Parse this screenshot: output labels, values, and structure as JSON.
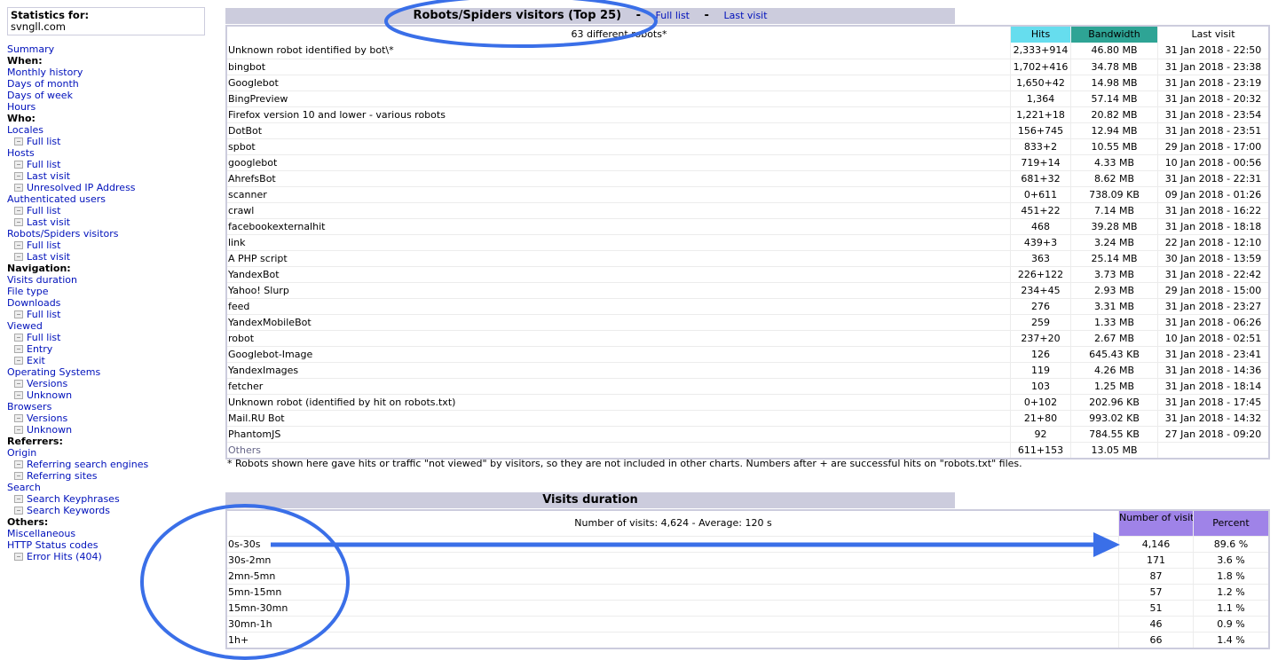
{
  "sidebar": {
    "stat_label": "Statistics for:",
    "site": "svngll.com",
    "items": [
      {
        "label": "Summary",
        "type": "link"
      },
      {
        "label": "When:",
        "type": "header"
      },
      {
        "label": "Monthly history",
        "type": "link"
      },
      {
        "label": "Days of month",
        "type": "link"
      },
      {
        "label": "Days of week",
        "type": "link"
      },
      {
        "label": "Hours",
        "type": "link"
      },
      {
        "label": "Who:",
        "type": "header"
      },
      {
        "label": "Locales",
        "type": "link"
      },
      {
        "label": "Full list",
        "type": "sub"
      },
      {
        "label": "Hosts",
        "type": "link"
      },
      {
        "label": "Full list",
        "type": "sub"
      },
      {
        "label": "Last visit",
        "type": "sub"
      },
      {
        "label": "Unresolved IP Address",
        "type": "sub"
      },
      {
        "label": "Authenticated users",
        "type": "link"
      },
      {
        "label": "Full list",
        "type": "sub"
      },
      {
        "label": "Last visit",
        "type": "sub"
      },
      {
        "label": "Robots/Spiders visitors",
        "type": "link"
      },
      {
        "label": "Full list",
        "type": "sub"
      },
      {
        "label": "Last visit",
        "type": "sub"
      },
      {
        "label": "Navigation:",
        "type": "header"
      },
      {
        "label": "Visits duration",
        "type": "link"
      },
      {
        "label": "File type",
        "type": "link"
      },
      {
        "label": "Downloads",
        "type": "link"
      },
      {
        "label": "Full list",
        "type": "sub"
      },
      {
        "label": "Viewed",
        "type": "link"
      },
      {
        "label": "Full list",
        "type": "sub"
      },
      {
        "label": "Entry",
        "type": "sub"
      },
      {
        "label": "Exit",
        "type": "sub"
      },
      {
        "label": "Operating Systems",
        "type": "link"
      },
      {
        "label": "Versions",
        "type": "sub"
      },
      {
        "label": "Unknown",
        "type": "sub"
      },
      {
        "label": "Browsers",
        "type": "link"
      },
      {
        "label": "Versions",
        "type": "sub"
      },
      {
        "label": "Unknown",
        "type": "sub"
      },
      {
        "label": "Referrers:",
        "type": "header"
      },
      {
        "label": "Origin",
        "type": "link"
      },
      {
        "label": "Referring search engines",
        "type": "sub"
      },
      {
        "label": "Referring sites",
        "type": "sub"
      },
      {
        "label": "Search",
        "type": "link"
      },
      {
        "label": "Search Keyphrases",
        "type": "sub"
      },
      {
        "label": "Search Keywords",
        "type": "sub"
      },
      {
        "label": "Others:",
        "type": "header"
      },
      {
        "label": "Miscellaneous",
        "type": "link"
      },
      {
        "label": "HTTP Status codes",
        "type": "link"
      },
      {
        "label": "Error Hits (404)",
        "type": "sub"
      }
    ]
  },
  "robots": {
    "title": "Robots/Spiders visitors (Top 25)",
    "sep": "-",
    "full_list": "Full list",
    "last_visit": "Last visit",
    "count_label": "63 different robots*",
    "col_hits": "Hits",
    "col_bandwidth": "Bandwidth",
    "col_last_visit": "Last visit",
    "rows": [
      {
        "name": "Unknown robot identified by bot\\*",
        "hits": "2,333+914",
        "bw": "46.80 MB",
        "last": "31 Jan 2018 - 22:50"
      },
      {
        "name": "bingbot",
        "hits": "1,702+416",
        "bw": "34.78 MB",
        "last": "31 Jan 2018 - 23:38"
      },
      {
        "name": "Googlebot",
        "hits": "1,650+42",
        "bw": "14.98 MB",
        "last": "31 Jan 2018 - 23:19"
      },
      {
        "name": "BingPreview",
        "hits": "1,364",
        "bw": "57.14 MB",
        "last": "31 Jan 2018 - 20:32"
      },
      {
        "name": "Firefox version 10 and lower - various robots",
        "hits": "1,221+18",
        "bw": "20.82 MB",
        "last": "31 Jan 2018 - 23:54"
      },
      {
        "name": "DotBot",
        "hits": "156+745",
        "bw": "12.94 MB",
        "last": "31 Jan 2018 - 23:51"
      },
      {
        "name": "spbot",
        "hits": "833+2",
        "bw": "10.55 MB",
        "last": "29 Jan 2018 - 17:00"
      },
      {
        "name": "googlebot",
        "hits": "719+14",
        "bw": "4.33 MB",
        "last": "10 Jan 2018 - 00:56"
      },
      {
        "name": "AhrefsBot",
        "hits": "681+32",
        "bw": "8.62 MB",
        "last": "31 Jan 2018 - 22:31"
      },
      {
        "name": "scanner",
        "hits": "0+611",
        "bw": "738.09 KB",
        "last": "09 Jan 2018 - 01:26"
      },
      {
        "name": "crawl",
        "hits": "451+22",
        "bw": "7.14 MB",
        "last": "31 Jan 2018 - 16:22"
      },
      {
        "name": "facebookexternalhit",
        "hits": "468",
        "bw": "39.28 MB",
        "last": "31 Jan 2018 - 18:18"
      },
      {
        "name": "link",
        "hits": "439+3",
        "bw": "3.24 MB",
        "last": "22 Jan 2018 - 12:10"
      },
      {
        "name": "A PHP script",
        "hits": "363",
        "bw": "25.14 MB",
        "last": "30 Jan 2018 - 13:59"
      },
      {
        "name": "YandexBot",
        "hits": "226+122",
        "bw": "3.73 MB",
        "last": "31 Jan 2018 - 22:42"
      },
      {
        "name": "Yahoo! Slurp",
        "hits": "234+45",
        "bw": "2.93 MB",
        "last": "29 Jan 2018 - 15:00"
      },
      {
        "name": "feed",
        "hits": "276",
        "bw": "3.31 MB",
        "last": "31 Jan 2018 - 23:27"
      },
      {
        "name": "YandexMobileBot",
        "hits": "259",
        "bw": "1.33 MB",
        "last": "31 Jan 2018 - 06:26"
      },
      {
        "name": "robot",
        "hits": "237+20",
        "bw": "2.67 MB",
        "last": "10 Jan 2018 - 02:51"
      },
      {
        "name": "Googlebot-Image",
        "hits": "126",
        "bw": "645.43 KB",
        "last": "31 Jan 2018 - 23:41"
      },
      {
        "name": "YandexImages",
        "hits": "119",
        "bw": "4.26 MB",
        "last": "31 Jan 2018 - 14:36"
      },
      {
        "name": "fetcher",
        "hits": "103",
        "bw": "1.25 MB",
        "last": "31 Jan 2018 - 18:14"
      },
      {
        "name": "Unknown robot (identified by hit on robots.txt)",
        "hits": "0+102",
        "bw": "202.96 KB",
        "last": "31 Jan 2018 - 17:45"
      },
      {
        "name": "Mail.RU Bot",
        "hits": "21+80",
        "bw": "993.02 KB",
        "last": "31 Jan 2018 - 14:32"
      },
      {
        "name": "PhantomJS",
        "hits": "92",
        "bw": "784.55 KB",
        "last": "27 Jan 2018 - 09:20"
      }
    ],
    "others": {
      "name": "Others",
      "hits": "611+153",
      "bw": "13.05 MB",
      "last": ""
    },
    "footnote": "* Robots shown here gave hits or traffic \"not viewed\" by visitors, so they are not included in other charts. Numbers after + are successful hits on \"robots.txt\" files."
  },
  "visits": {
    "title": "Visits duration",
    "summary": "Number of visits: 4,624 - Average: 120 s",
    "col_num": "Number of visits",
    "col_pct": "Percent",
    "rows": [
      {
        "range": "0s-30s",
        "num": "4,146",
        "pct": "89.6 %"
      },
      {
        "range": "30s-2mn",
        "num": "171",
        "pct": "3.6 %"
      },
      {
        "range": "2mn-5mn",
        "num": "87",
        "pct": "1.8 %"
      },
      {
        "range": "5mn-15mn",
        "num": "57",
        "pct": "1.2 %"
      },
      {
        "range": "15mn-30mn",
        "num": "51",
        "pct": "1.1 %"
      },
      {
        "range": "30mn-1h",
        "num": "46",
        "pct": "0.9 %"
      },
      {
        "range": "1h+",
        "num": "66",
        "pct": "1.4 %"
      }
    ]
  },
  "colors": {
    "title_bg": "#ccccdd",
    "hits_header": "#66ddee",
    "bandwidth_header": "#2ea495",
    "visits_header": "#9f83e8",
    "annotation": "#3a6fe8"
  }
}
